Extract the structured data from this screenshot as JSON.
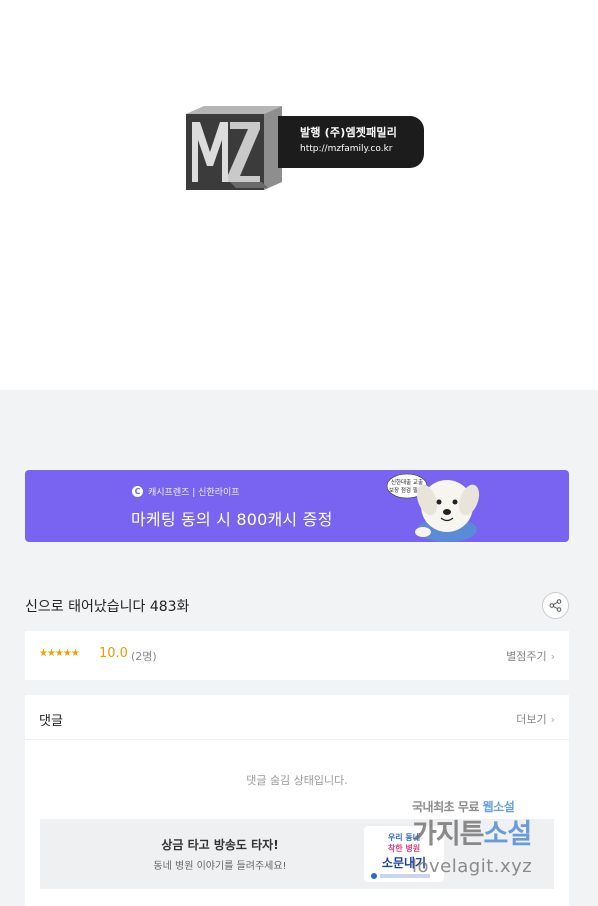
{
  "publisher": {
    "logo_text": "MZ",
    "title": "발행 (주)엠젯패밀리",
    "url": "http://mzfamily.co.kr"
  },
  "ad_banner": {
    "brand": "캐시프렌즈 | 신한라이프",
    "headline": "마케팅 동의 시 800캐시 증정",
    "mascot_bubble": [
      "신한대출 교출",
      "보장 점검 필수!"
    ]
  },
  "episode": {
    "title": "신으로 태어났습니다 483화"
  },
  "rating": {
    "stars": "★★★★★",
    "score": "10.0",
    "count": "(2명)",
    "rate_label": "별점주기"
  },
  "comments": {
    "title": "댓글",
    "more_label": "더보기",
    "hidden_text": "댓글 숨김 상태입니다."
  },
  "promo": {
    "title": "상금 타고 방송도 타자!",
    "subtitle": "동네 병원 이야기를 들려주세요!",
    "art_text": [
      "우리 동네",
      "착한 병원",
      "소문내기"
    ]
  },
  "watermark": {
    "line1_prefix": "국내최초 무료 ",
    "line1_highlight": "웹소설",
    "line2_prefix": "가지튼",
    "line2_highlight": "소설",
    "line3": "lovelagit.xyz"
  },
  "colors": {
    "ad_background": "#7864f0",
    "rating_star": "#f0a000",
    "page_gray": "#f2f3f5"
  }
}
